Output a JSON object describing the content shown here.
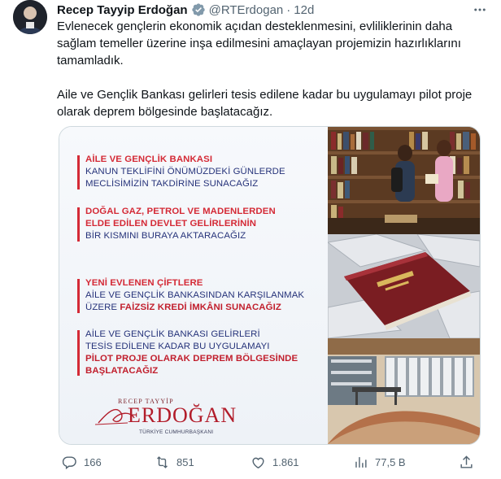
{
  "author": {
    "name": "Recep Tayyip Erdoğan",
    "handle": "@RTErdogan",
    "separator": "·",
    "time": "12d"
  },
  "tweet": {
    "paragraph1": "Evlenecek gençlerin ekonomik açıdan desteklenmesini, evliliklerinin daha sağlam temeller üzerine inşa edilmesini amaçlayan projemizin hazırlıklarını tamamladık.",
    "paragraph2": "Aile ve Gençlik Bankası gelirleri tesis edilene kadar bu uygulamayı pilot proje olarak deprem bölgesinde başlatacağız."
  },
  "media": {
    "block1": {
      "l1": "AİLE VE GENÇLİK BANKASI",
      "l2": "KANUN TEKLİFİNİ ÖNÜMÜZDEKİ GÜNLERDE",
      "l3": "MECLİSİMİZİN TAKDİRİNE SUNACAĞIZ"
    },
    "block2": {
      "l1": "DOĞAL GAZ, PETROL VE MADENLERDEN",
      "l2": "ELDE EDİLEN DEVLET GELİRLERİNİN",
      "l3": "BİR KISMINI BURAYA AKTARACAĞIZ"
    },
    "block3": {
      "l1": "YENİ EVLENEN ÇİFTLERE",
      "l2": "AİLE VE GENÇLİK BANKASINDAN KARŞILANMAK",
      "l3a": "ÜZERE ",
      "l3b": "FAİZSİZ KREDİ İMKÂNI SUNACAĞIZ"
    },
    "block4": {
      "l1": "AİLE VE GENÇLİK BANKASI GELİRLERİ",
      "l2": "TESİS EDİLENE KADAR BU UYGULAMAYI",
      "l3": "PİLOT PROJE OLARAK DEPREM BÖLGESİNDE",
      "l4": "BAŞLATACAĞIZ"
    },
    "signature": {
      "name_top": "RECEP TAYYİP",
      "name_big": "ERDOĞAN",
      "title": "TÜRKİYE CUMHURBAŞKANI"
    },
    "colors": {
      "red": "#d42a36",
      "blue": "#26337a"
    }
  },
  "actions": {
    "reply": "166",
    "retweet": "851",
    "like": "1.861",
    "views": "77,5 B"
  },
  "icons": [
    "verified-badge-icon",
    "more-icon",
    "reply-icon",
    "retweet-icon",
    "like-icon",
    "views-icon",
    "share-icon"
  ]
}
